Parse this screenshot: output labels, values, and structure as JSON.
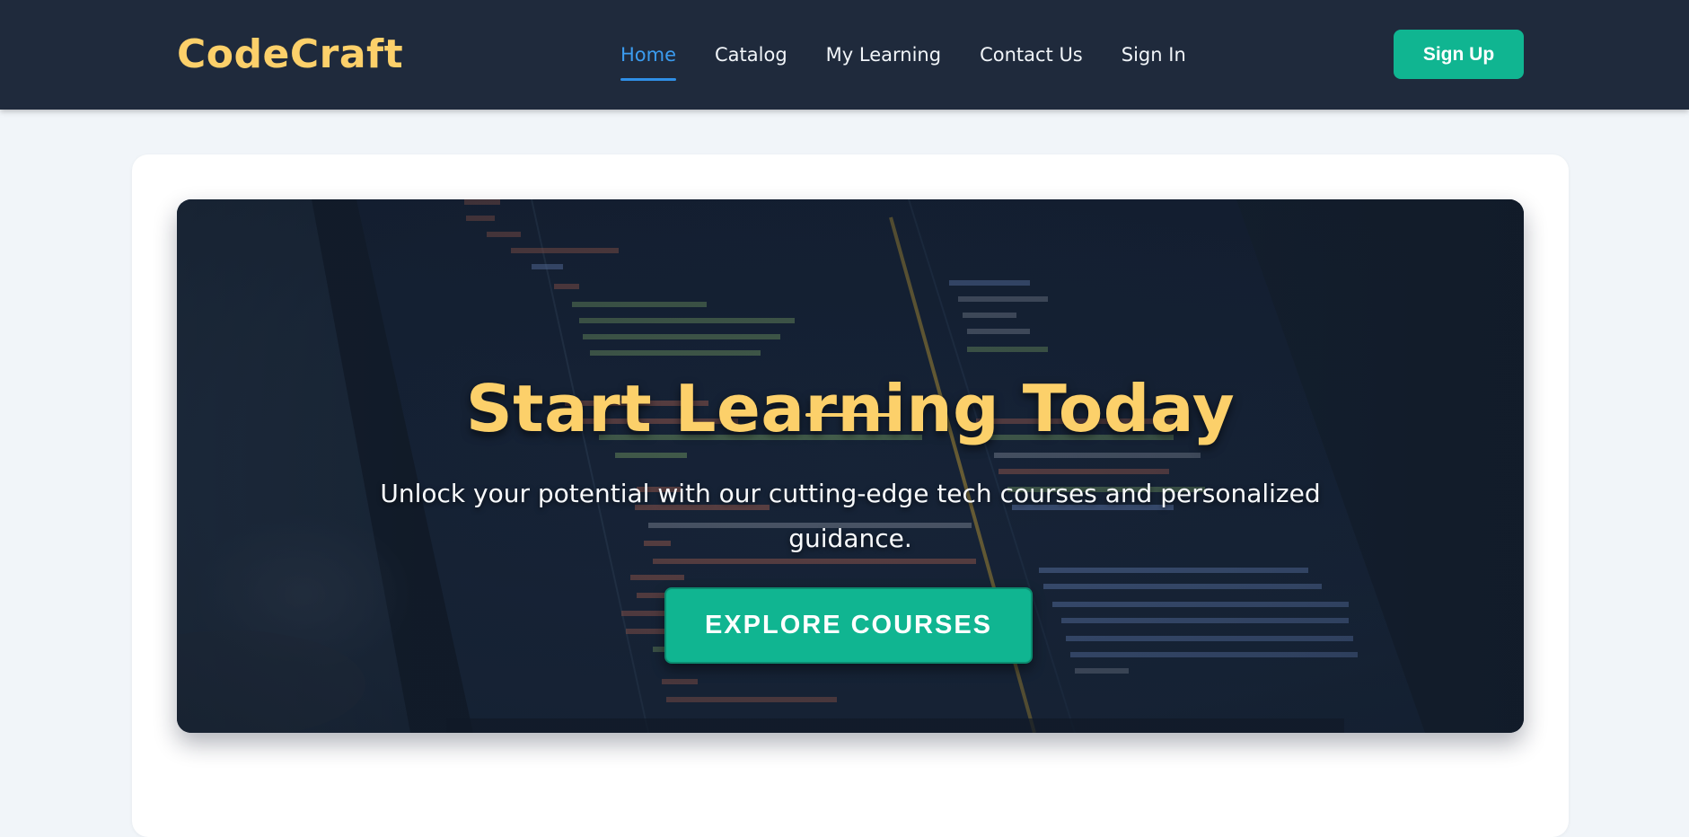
{
  "brand": {
    "name": "CodeCraft"
  },
  "nav": {
    "items": [
      {
        "label": "Home",
        "active": true
      },
      {
        "label": "Catalog",
        "active": false
      },
      {
        "label": "My Learning",
        "active": false
      },
      {
        "label": "Contact Us",
        "active": false
      },
      {
        "label": "Sign In",
        "active": false
      }
    ],
    "signup_label": "Sign Up"
  },
  "hero": {
    "title": "Start Learning Today",
    "subtitle": "Unlock your potential with our cutting-edge tech courses and personalized guidance.",
    "cta_label": "EXPLORE COURSES",
    "background_image": "code-editor-laptop-photo"
  },
  "colors": {
    "navbar_bg": "#1f2a3c",
    "brand_yellow": "#fcd06a",
    "accent_green": "#10b591",
    "active_link_blue": "#3b9cf0",
    "page_bg": "#f1f5f9"
  }
}
